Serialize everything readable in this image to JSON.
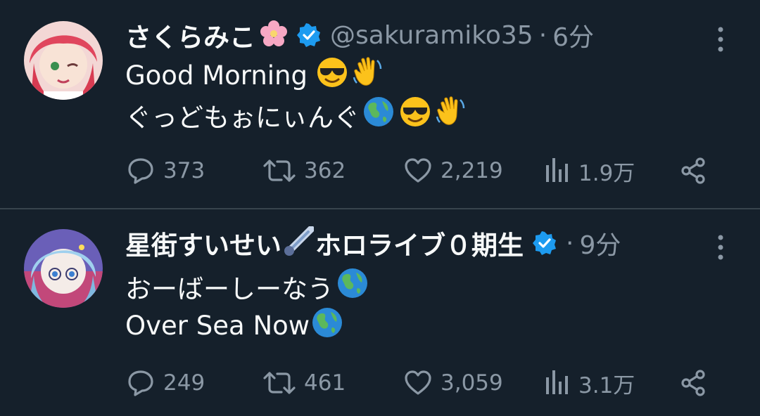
{
  "tweets": [
    {
      "name": "さくらみこ",
      "name_emoji": "cherry-blossom",
      "handle": "@sakuramiko35",
      "sep": "·",
      "time": "6分",
      "lines": [
        "Good Morning",
        "ぐっどもぉにぃんぐ"
      ],
      "line_emojis": [
        [
          "smiling-face-with-sunglasses",
          "waving-hand"
        ],
        [
          "globe",
          "smiling-face-with-sunglasses",
          "waving-hand"
        ]
      ],
      "replies": "373",
      "retweets": "362",
      "likes": "2,219",
      "views": "1.9万"
    },
    {
      "name": "星街すいせい",
      "name_suffix": "ホロライブ０期生",
      "name_emoji": "comet",
      "sep": "·",
      "time": "9分",
      "lines": [
        "おーばーしーなう",
        "Over Sea Now"
      ],
      "line_emojis": [
        [
          "globe"
        ],
        [
          "globe"
        ]
      ],
      "replies": "249",
      "retweets": "461",
      "likes": "3,059",
      "views": "3.1万"
    }
  ],
  "colors": {
    "background": "#15202b",
    "text": "#f7f9f9",
    "muted": "#8b98a5",
    "verified": "#1d9bf0",
    "divider": "#38444d"
  }
}
